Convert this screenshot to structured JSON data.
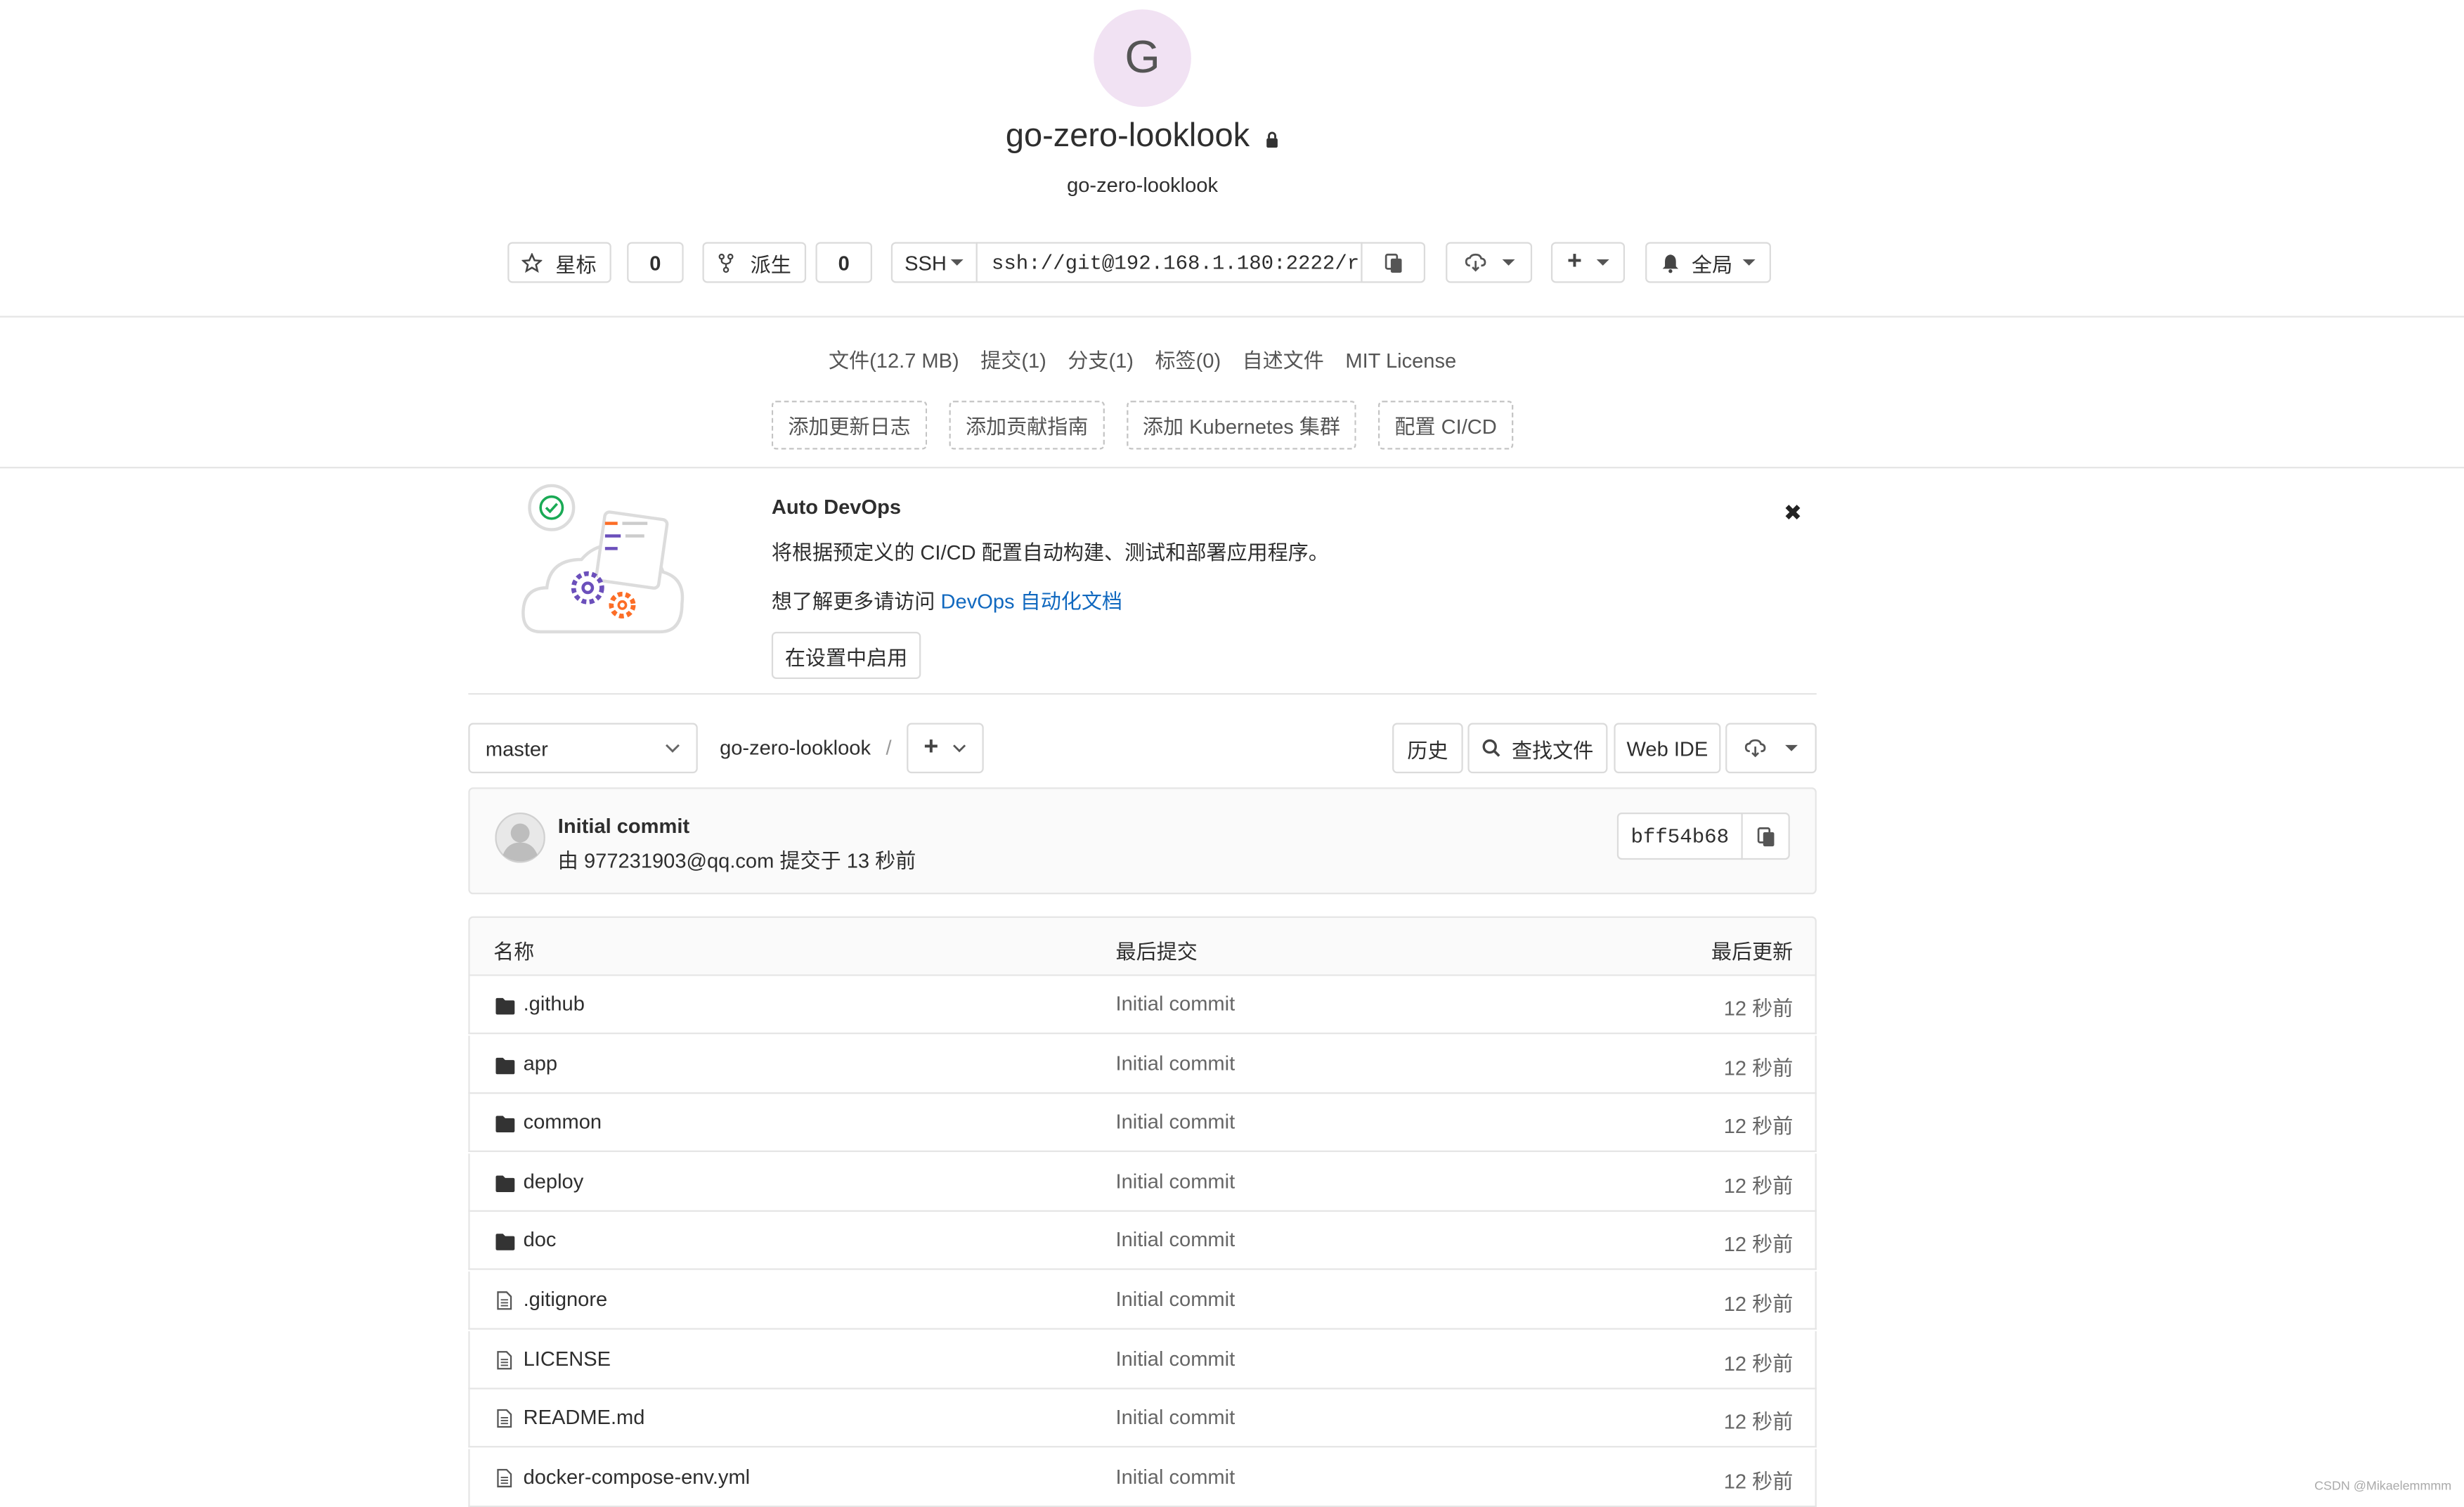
{
  "project": {
    "avatar_letter": "G",
    "name": "go-zero-looklook",
    "description": "go-zero-looklook"
  },
  "actions": {
    "star_label": "星标",
    "star_count": "0",
    "fork_label": "派生",
    "fork_count": "0",
    "protocol_label": "SSH",
    "clone_url": "ssh://git@192.168.1.180:2222/r",
    "notification_label": "全局"
  },
  "stats": {
    "files": "文件(12.7 MB)",
    "commits": "提交(1)",
    "branches": "分支(1)",
    "tags": "标签(0)",
    "readme": "自述文件",
    "license": "MIT License"
  },
  "quick_actions": [
    "添加更新日志",
    "添加贡献指南",
    "添加 Kubernetes 集群",
    "配置 CI/CD"
  ],
  "auto_devops": {
    "title": "Auto DevOps",
    "description": "将根据预定义的 CI/CD 配置自动构建、测试和部署应用程序。",
    "learn_more_prefix": "想了解更多请访问",
    "learn_more_link": "DevOps 自动化文档",
    "enable_button": "在设置中启用"
  },
  "toolbar": {
    "branch": "master",
    "path": "go-zero-looklook",
    "separator": "/",
    "history": "历史",
    "find_file": "查找文件",
    "web_ide": "Web IDE"
  },
  "last_commit": {
    "title": "Initial commit",
    "author_prefix": "由",
    "author": "977231903@qq.com",
    "time": "提交于 13 秒前",
    "sha": "bff54b68"
  },
  "tree": {
    "headers": [
      "名称",
      "最后提交",
      "最后更新"
    ],
    "rows": [
      {
        "name": ".github",
        "type": "folder",
        "commit": "Initial commit",
        "updated": "12 秒前"
      },
      {
        "name": "app",
        "type": "folder",
        "commit": "Initial commit",
        "updated": "12 秒前"
      },
      {
        "name": "common",
        "type": "folder",
        "commit": "Initial commit",
        "updated": "12 秒前"
      },
      {
        "name": "deploy",
        "type": "folder",
        "commit": "Initial commit",
        "updated": "12 秒前"
      },
      {
        "name": "doc",
        "type": "folder",
        "commit": "Initial commit",
        "updated": "12 秒前"
      },
      {
        "name": ".gitignore",
        "type": "file",
        "commit": "Initial commit",
        "updated": "12 秒前"
      },
      {
        "name": "LICENSE",
        "type": "file",
        "commit": "Initial commit",
        "updated": "12 秒前"
      },
      {
        "name": "README.md",
        "type": "file",
        "commit": "Initial commit",
        "updated": "12 秒前"
      },
      {
        "name": "docker-compose-env.yml",
        "type": "file",
        "commit": "Initial commit",
        "updated": "12 秒前"
      }
    ]
  },
  "watermark": "CSDN @Mikaelemmmm",
  "colors": {
    "link": "#1068bf",
    "avatar_bg": "#f1e2f3",
    "border": "#dbdbdb"
  }
}
